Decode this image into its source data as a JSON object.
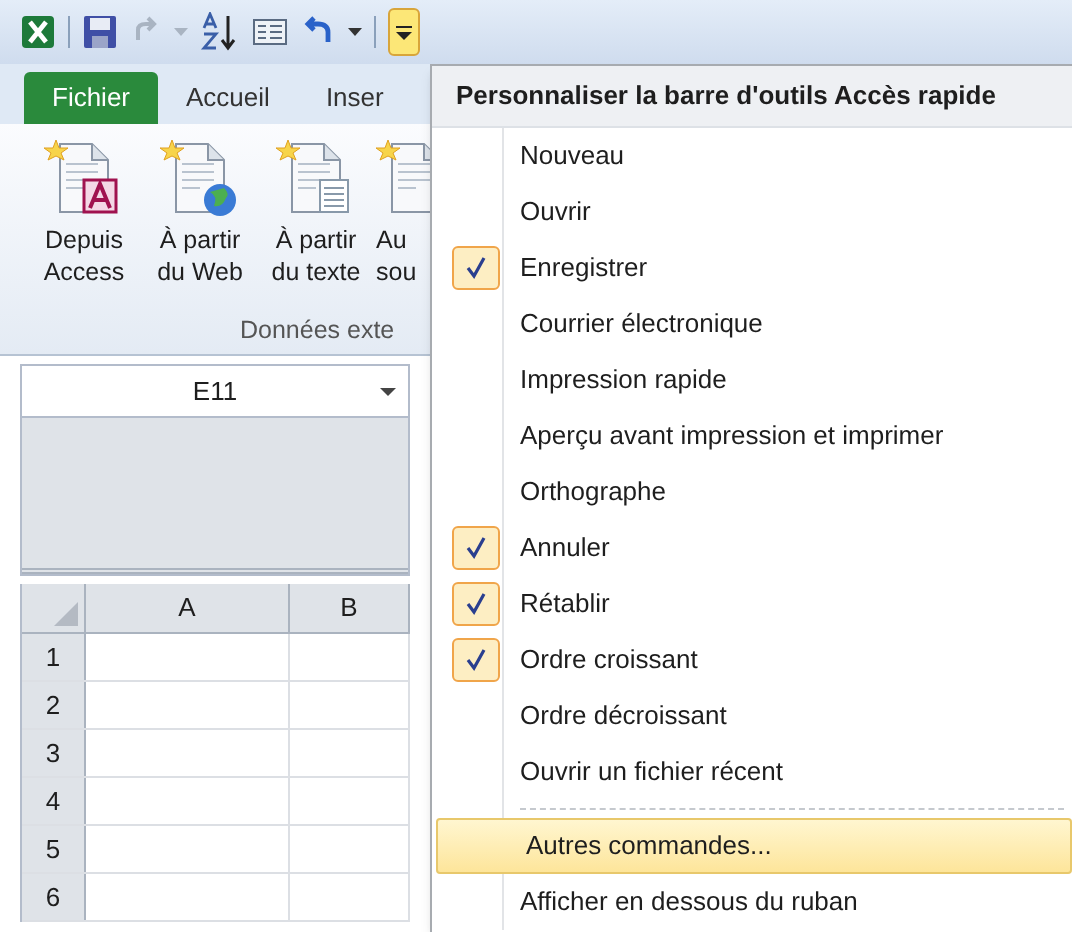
{
  "quick_access": {
    "customize_pressed": true
  },
  "tabs": [
    {
      "label": "Fichier",
      "selected": true
    },
    {
      "label": "Accueil",
      "selected": false
    },
    {
      "label": "Inser",
      "selected": false
    }
  ],
  "ribbon": {
    "buttons": [
      {
        "label": "Depuis Access",
        "kind": "access"
      },
      {
        "label": "À partir du Web",
        "kind": "web"
      },
      {
        "label": "À partir du texte",
        "kind": "text"
      },
      {
        "label": "Au sou",
        "kind": "other"
      }
    ],
    "group_label": "Données exte"
  },
  "name_box": {
    "value": "E11"
  },
  "sheet": {
    "columns": [
      "A",
      "B"
    ],
    "rows": [
      "1",
      "2",
      "3",
      "4",
      "5",
      "6"
    ]
  },
  "menu": {
    "title": "Personnaliser la barre d'outils Accès rapide",
    "options": [
      {
        "label": "Nouveau",
        "checked": false
      },
      {
        "label": "Ouvrir",
        "checked": false
      },
      {
        "label": "Enregistrer",
        "checked": true
      },
      {
        "label": "Courrier électronique",
        "checked": false
      },
      {
        "label": "Impression rapide",
        "checked": false
      },
      {
        "label": "Aperçu avant impression et imprimer",
        "checked": false
      },
      {
        "label": "Orthographe",
        "checked": false
      },
      {
        "label": "Annuler",
        "checked": true
      },
      {
        "label": "Rétablir",
        "checked": true
      },
      {
        "label": "Ordre croissant",
        "checked": true
      },
      {
        "label": "Ordre décroissant",
        "checked": false
      },
      {
        "label": "Ouvrir un fichier récent",
        "checked": false
      }
    ],
    "commands": [
      {
        "label": "Autres commandes...",
        "selected": true
      },
      {
        "label": "Afficher en dessous du ruban",
        "selected": false
      }
    ]
  }
}
